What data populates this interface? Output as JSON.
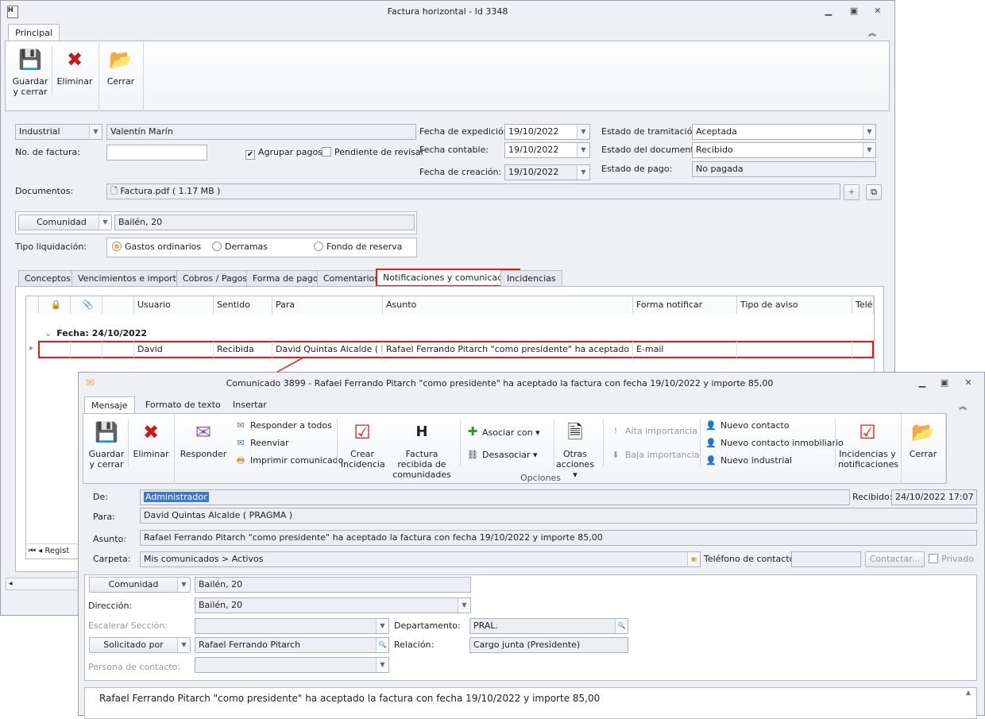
{
  "main_window": {
    "title": "Factura horizontal - Id 3348",
    "ribbon_tab": "Principal",
    "toolbar": {
      "save": "Guardar y cerrar",
      "delete": "Eliminar",
      "close": "Cerrar"
    },
    "form": {
      "entity_type": "Industrial",
      "entity_name": "Valentín Marín",
      "invoice_no_label": "No. de factura:",
      "invoice_no": "",
      "group_payments": "Agrupar pagos",
      "pending_review": "Pendiente de revisar",
      "issue_date_label": "Fecha de expedición:",
      "issue_date": "19/10/2022",
      "accounting_date_label": "Fecha contable:",
      "accounting_date": "19/10/2022",
      "creation_date_label": "Fecha de creación:",
      "creation_date": "19/10/2022",
      "processing_status_label": "Estado de tramitación:",
      "processing_status": "Aceptada",
      "document_status_label": "Estado del documento:",
      "document_status": "Recibido",
      "payment_status_label": "Estado de pago:",
      "payment_status": "No pagada",
      "documents_label": "Documentos:",
      "document_file": "Factura.pdf ( 1.17 MB )",
      "community_button": "Comunidad",
      "community": "Bailén, 20",
      "settlement_label": "Tipo liquidación:",
      "settlement_options": [
        "Gastos ordinarios",
        "Derramas",
        "Fondo de reserva"
      ]
    },
    "tabs": [
      "Conceptos",
      "Vencimientos e importes",
      "Cobros / Pagos",
      "Forma de pago",
      "Comentarios",
      "Notificaciones y comunicados",
      "Incidencias"
    ],
    "grid": {
      "columns": [
        "Usuario",
        "Sentido",
        "Para",
        "Asunto",
        "Forma notificar",
        "Tipo de aviso",
        "Teléf"
      ],
      "group": "Fecha: 24/10/2022",
      "rows": [
        {
          "usuario": "David",
          "sentido": "Recibida",
          "para": "David Quintas Alcalde ( P...",
          "asunto": "Rafael Ferrando Pitarch \"como presidente\" ha aceptado la fac...",
          "forma": "E-mail",
          "tipo": ""
        }
      ],
      "footer": "Regist"
    }
  },
  "message_window": {
    "title": "Comunicado 3899 - Rafael Ferrando Pitarch \"como presidente\" ha aceptado la factura  con fecha 19/10/2022 y importe 85,00",
    "tabs": [
      "Mensaje",
      "Formato de texto",
      "Insertar"
    ],
    "ribbon": {
      "save": "Guardar y cerrar",
      "delete": "Eliminar",
      "reply": "Responder",
      "reply_all": "Responder a todos",
      "forward": "Reenviar",
      "print": "Imprimir comunicado",
      "create_incident": "Crear incidencia",
      "received_invoice": "Factura recibida de comunidades",
      "associate": "Asociar con",
      "disassociate": "Desasociar",
      "other_actions": "Otras acciones",
      "high_importance": "Alta importancia",
      "low_importance": "Baja importancia",
      "new_contact": "Nuevo contacto",
      "new_real_estate_contact": "Nuevo contacto inmobiliario",
      "new_industrial": "Nuevo industrial",
      "incidents_notifications": "Incidencias y notificaciones",
      "close": "Cerrar",
      "group_label": "Opciones"
    },
    "fields": {
      "from_label": "De:",
      "from": "Administrador",
      "received_label": "Recibido:",
      "received": "24/10/2022 17:07",
      "to_label": "Para:",
      "to": "David Quintas Alcalde ( PRAGMA )",
      "subject_label": "Asunto:",
      "subject": "Rafael Ferrando Pitarch \"como presidente\" ha aceptado la factura  con fecha 19/10/2022 y importe 85,00",
      "folder_label": "Carpeta:",
      "folder": "Mis comunicados > Activos",
      "phone_label": "Teléfono de contacto:",
      "phone": "",
      "contact_button": "Contactar...",
      "private": "Privado",
      "community_button": "Comunidad",
      "community": "Bailén, 20",
      "address_label": "Dirección:",
      "address": "Bailén, 20",
      "stair_label": "Escalera/ Sección:",
      "stair": "",
      "department_label": "Departamento:",
      "department": "PRAL.",
      "requested_by_button": "Solicitado por",
      "requested_by": "Rafael Ferrando Pitarch",
      "relation_label": "Relación:",
      "relation": "Cargo junta (Presidente)",
      "contact_person_label": "Persona de contacto:",
      "contact_person": ""
    },
    "body": "Rafael Ferrando Pitarch \"como presidente\" ha aceptado la factura  con fecha 19/10/2022 y importe 85,00"
  },
  "colors": {
    "highlight": "#e31b1b",
    "selection": "#3a78d4"
  }
}
